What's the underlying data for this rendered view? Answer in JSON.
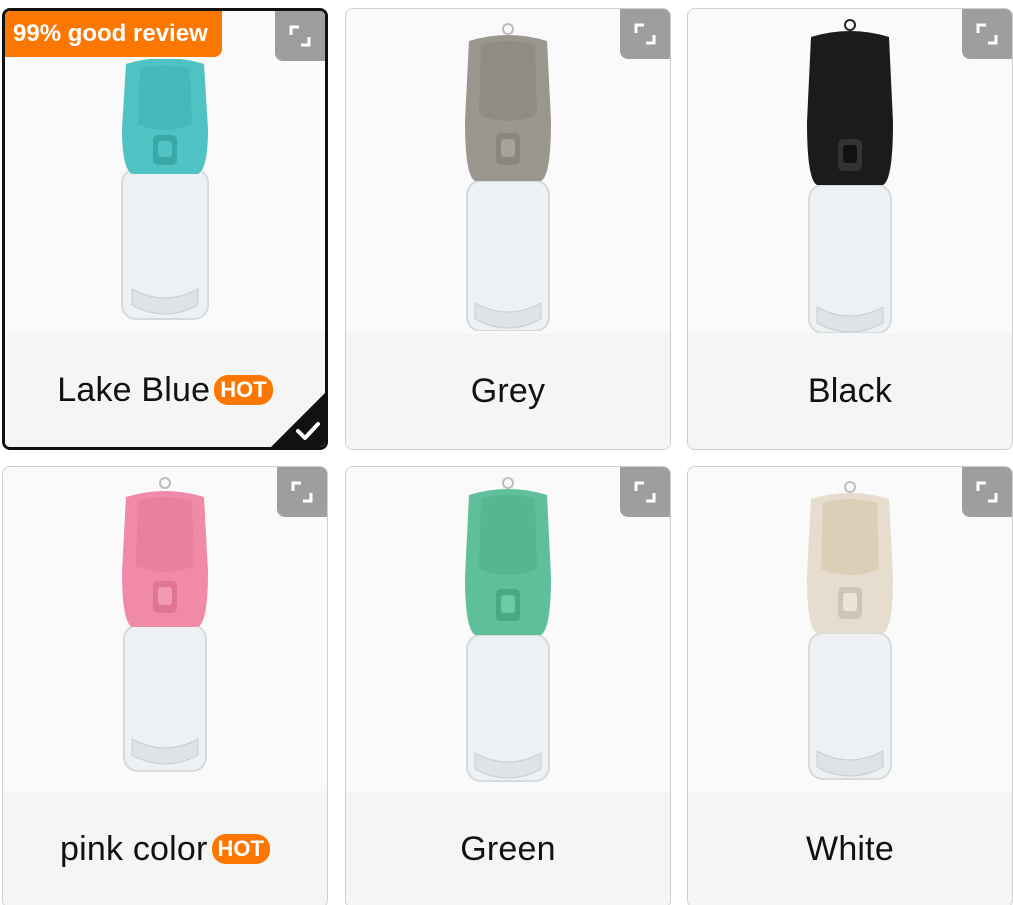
{
  "options": [
    {
      "label": "Lake Blue",
      "hot": "HOT",
      "selected": true,
      "color": "#4fc3c4",
      "badge": "99% good review"
    },
    {
      "label": "Grey",
      "hot": "",
      "selected": false,
      "color": "#9b968e"
    },
    {
      "label": "Black",
      "hot": "",
      "selected": false,
      "color": "#1b1b1b"
    },
    {
      "label": "pink color",
      "hot": "HOT",
      "selected": false,
      "color": "#f08aa8"
    },
    {
      "label": "Green",
      "hot": "",
      "selected": false,
      "color": "#5fbf9b"
    },
    {
      "label": "White",
      "hot": "",
      "selected": false,
      "color": "#e6ddcf"
    }
  ],
  "colors": {
    "accent": "#fb7701",
    "selected_border": "#111111",
    "expand_bg": "#8e8e8e"
  },
  "icons": {
    "expand": "expand-icon",
    "check": "checkmark-icon"
  }
}
